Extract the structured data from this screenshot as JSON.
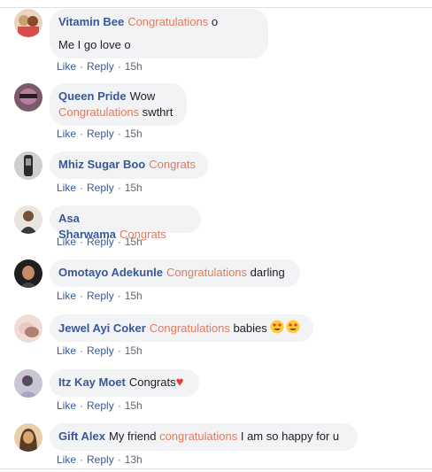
{
  "actions": {
    "like": "Like",
    "reply": "Reply",
    "dot": "·"
  },
  "comments": [
    {
      "author": "Vitamin Bee",
      "parts": [
        "Congratulations",
        " o"
      ],
      "line2": "Me I go love o",
      "time": "15h",
      "avatar_colors": [
        "#c9a26b",
        "#8a4a2f"
      ]
    },
    {
      "author": "Queen Pride",
      "parts": [
        "Wow"
      ],
      "line2_hl": "Congratulations",
      "line2": " swthrt",
      "time": "15h",
      "avatar_colors": [
        "#b87fa0",
        "#3b2b2b"
      ]
    },
    {
      "author": "Mhiz Sugar Boo",
      "parts": [
        "Congrats"
      ],
      "time": "15h",
      "avatar_colors": [
        "#9a9a9a",
        "#2a2a2a"
      ]
    },
    {
      "author": "Asa Sharwama",
      "parts": [
        "Congrats"
      ],
      "time": "15h",
      "avatar_colors": [
        "#d8d1c8",
        "#7a4f3a"
      ]
    },
    {
      "author": "Omotayo Adekunle",
      "parts": [
        "Congratulations",
        " darling"
      ],
      "time": "15h",
      "avatar_colors": [
        "#3a3a3a",
        "#c58b6a"
      ]
    },
    {
      "author": "Jewel Ayi Coker",
      "parts": [
        "Congratulations",
        " babies"
      ],
      "emoji": "😍😍",
      "time": "15h",
      "avatar_colors": [
        "#e6c9c4",
        "#b08070"
      ]
    },
    {
      "author": "Itz Kay Moet",
      "parts": [
        "Congrats"
      ],
      "emoji": "♥",
      "time": "15h",
      "avatar_colors": [
        "#a8a6b8",
        "#5a4a5a"
      ]
    },
    {
      "author": "Gift Alex",
      "prefix": "My friend ",
      "parts": [
        "congratulations",
        " I am so happy for u"
      ],
      "time": "13h",
      "avatar_colors": [
        "#d9a86a",
        "#5a3a2a"
      ]
    }
  ]
}
